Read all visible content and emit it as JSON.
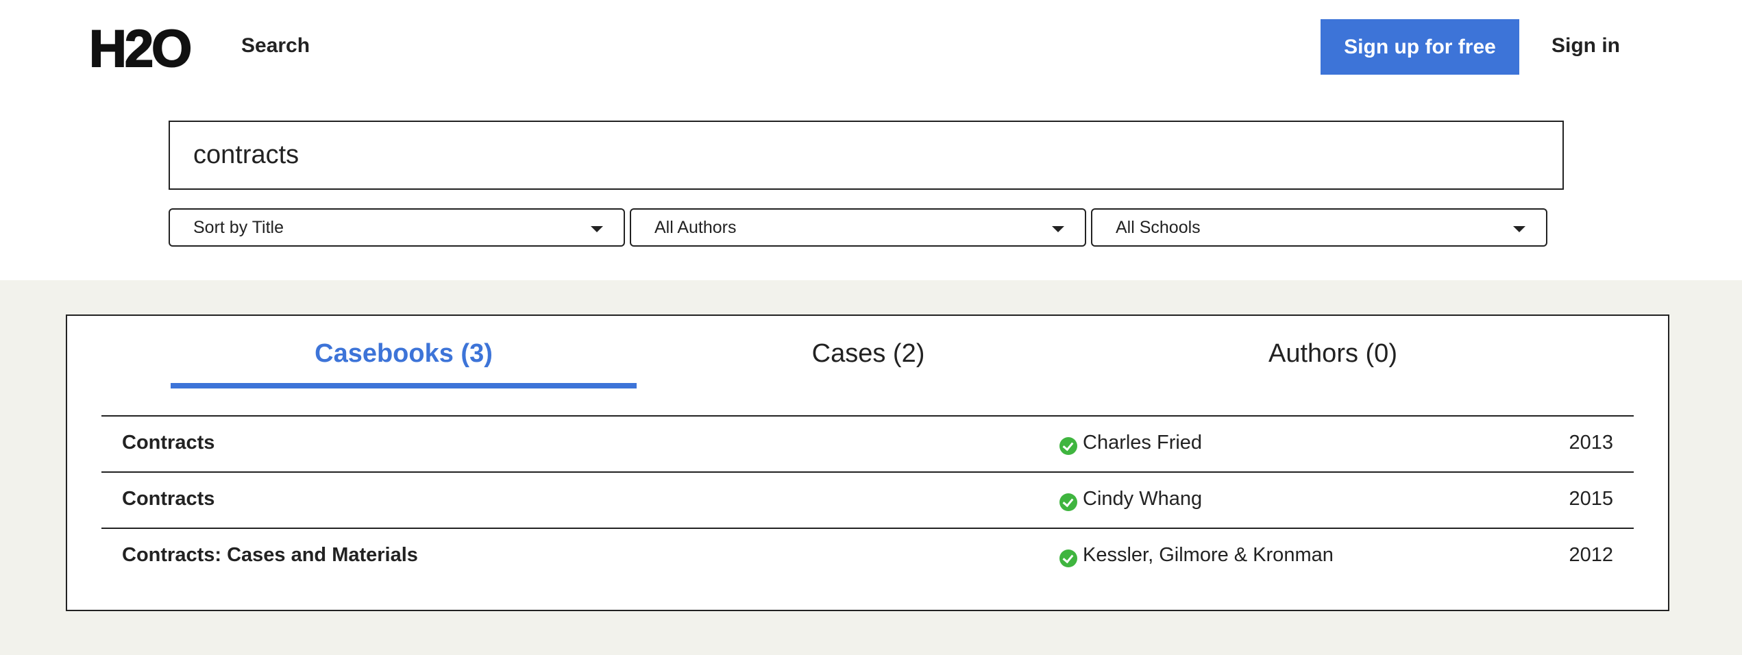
{
  "header": {
    "logo": "H2O",
    "nav_search": "Search",
    "signup_label": "Sign up for free",
    "signin_label": "Sign in"
  },
  "search": {
    "query": "contracts"
  },
  "filters": {
    "sort": "Sort by Title",
    "authors": "All Authors",
    "schools": "All Schools"
  },
  "tabs": [
    {
      "label": "Casebooks (3)",
      "active": true
    },
    {
      "label": "Cases (2)",
      "active": false
    },
    {
      "label": "Authors (0)",
      "active": false
    }
  ],
  "results": [
    {
      "title": "Contracts",
      "author": "Charles Fried",
      "year": "2013"
    },
    {
      "title": "Contracts",
      "author": "Cindy Whang",
      "year": "2015"
    },
    {
      "title": "Contracts: Cases and Materials",
      "author": "Kessler, Gilmore & Kronman",
      "year": "2012"
    }
  ],
  "colors": {
    "accent": "#3d74d8",
    "verified": "#3fb53f",
    "results_background": "#f2f2ec"
  },
  "icons": {
    "verified": "check-circle-icon",
    "dropdown": "caret-down-icon"
  }
}
